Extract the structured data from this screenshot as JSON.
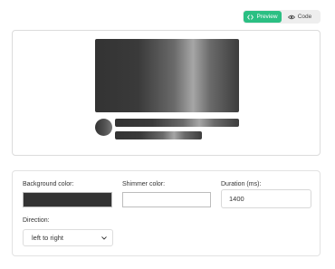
{
  "toggle": {
    "preview_label": "Preview",
    "code_label": "Code",
    "active": "preview",
    "accent_color": "#2bbf83",
    "preview_icon": "code-brackets-icon",
    "code_icon": "eye-icon"
  },
  "settings": {
    "background_label": "Background color:",
    "background_value": "#333333",
    "shimmer_label": "Shimmer color:",
    "shimmer_value": "#ffffff",
    "duration_label": "Duration (ms):",
    "duration_value": "1400",
    "direction_label": "Direction:",
    "direction_value": "left to right",
    "direction_icon": "chevron-down-icon"
  }
}
